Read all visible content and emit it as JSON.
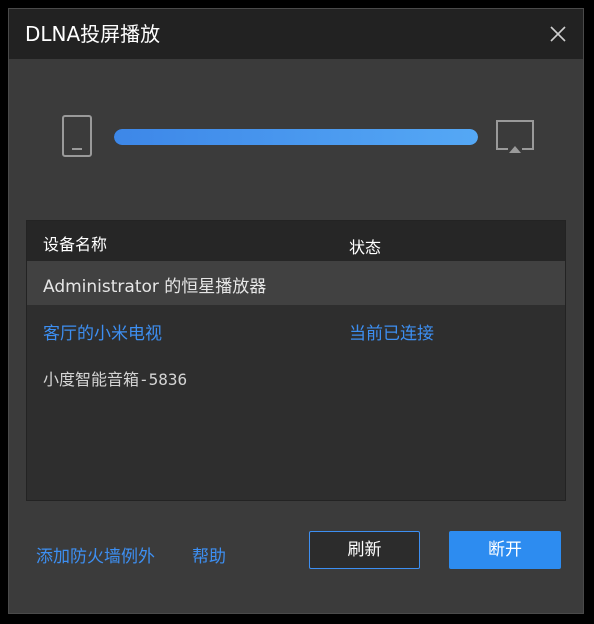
{
  "window": {
    "title": "DLNA投屏播放"
  },
  "cast": {
    "progress_percent": 100,
    "source_icon": "phone-icon",
    "target_icon": "tv-cast-icon",
    "accent_color": "#3d8ff2"
  },
  "device_list": {
    "columns": [
      "设备名称",
      "状态"
    ],
    "rows": [
      {
        "name": "Administrator 的恒星播放器",
        "status": "",
        "highlighted": true
      },
      {
        "name": "客厅的小米电视",
        "status": "当前已连接",
        "connected": true
      },
      {
        "name": "小度智能音箱-5836",
        "status": ""
      }
    ]
  },
  "footer": {
    "firewall_link": "添加防火墙例外",
    "help_link": "帮助",
    "refresh_button": "刷新",
    "disconnect_button": "断开"
  }
}
